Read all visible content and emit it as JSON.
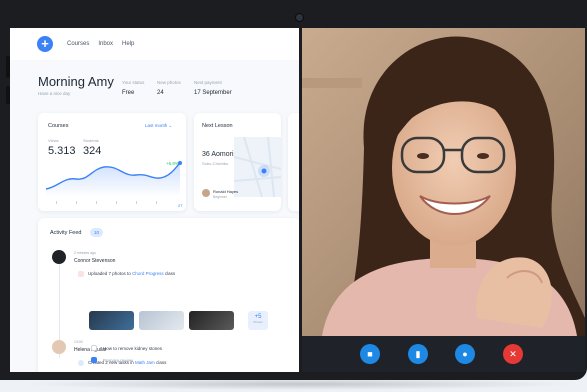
{
  "nav": {
    "items": [
      "Courses",
      "Inbox",
      "Help"
    ]
  },
  "greeting": {
    "title": "Morning Amy",
    "subtitle": "Have a nice day"
  },
  "stats": [
    {
      "label": "Your status",
      "value": "Free"
    },
    {
      "label": "New photos",
      "value": "24"
    },
    {
      "label": "Next payment",
      "value": "17 September"
    }
  ],
  "courses_card": {
    "title": "Courses",
    "filter": "Last month",
    "views_label": "Views",
    "views_value": "5.313",
    "students_label": "Students",
    "students_value": "324",
    "change": "+6.8%",
    "tick_end": "27"
  },
  "lesson_card": {
    "title": "Next Lesson",
    "room": "36 Aomori",
    "place": "Sobu-Chichibu",
    "person_name": "Ronald Hayes",
    "person_role": "Beginner"
  },
  "feed": {
    "title": "Activity Feed",
    "count": "10",
    "items": [
      {
        "time": "2 minutes ago",
        "name": "Connor Stevenson",
        "action": "Uploaded 7 photos to",
        "target": "Chord Progress",
        "suffix": "class"
      },
      {
        "time": "13:00",
        "name": "Helena Aguilar",
        "action": "Created 2 new tasks in",
        "target": "Math Jam",
        "suffix": "class"
      }
    ],
    "more_count": "+5",
    "more_label": "Photos",
    "tasks": [
      "How to remove kidney stones",
      "Prepare review"
    ]
  },
  "colors": {
    "accent": "#3b82f6",
    "video_blue": "#1e88e5",
    "end_call": "#e53935",
    "green": "#22c55e"
  },
  "video_controls": {
    "icons": [
      "video-camera-icon",
      "stats-icon",
      "chat-icon",
      "close-icon"
    ],
    "symbols": [
      "■",
      "▮",
      "●",
      "✕"
    ]
  }
}
